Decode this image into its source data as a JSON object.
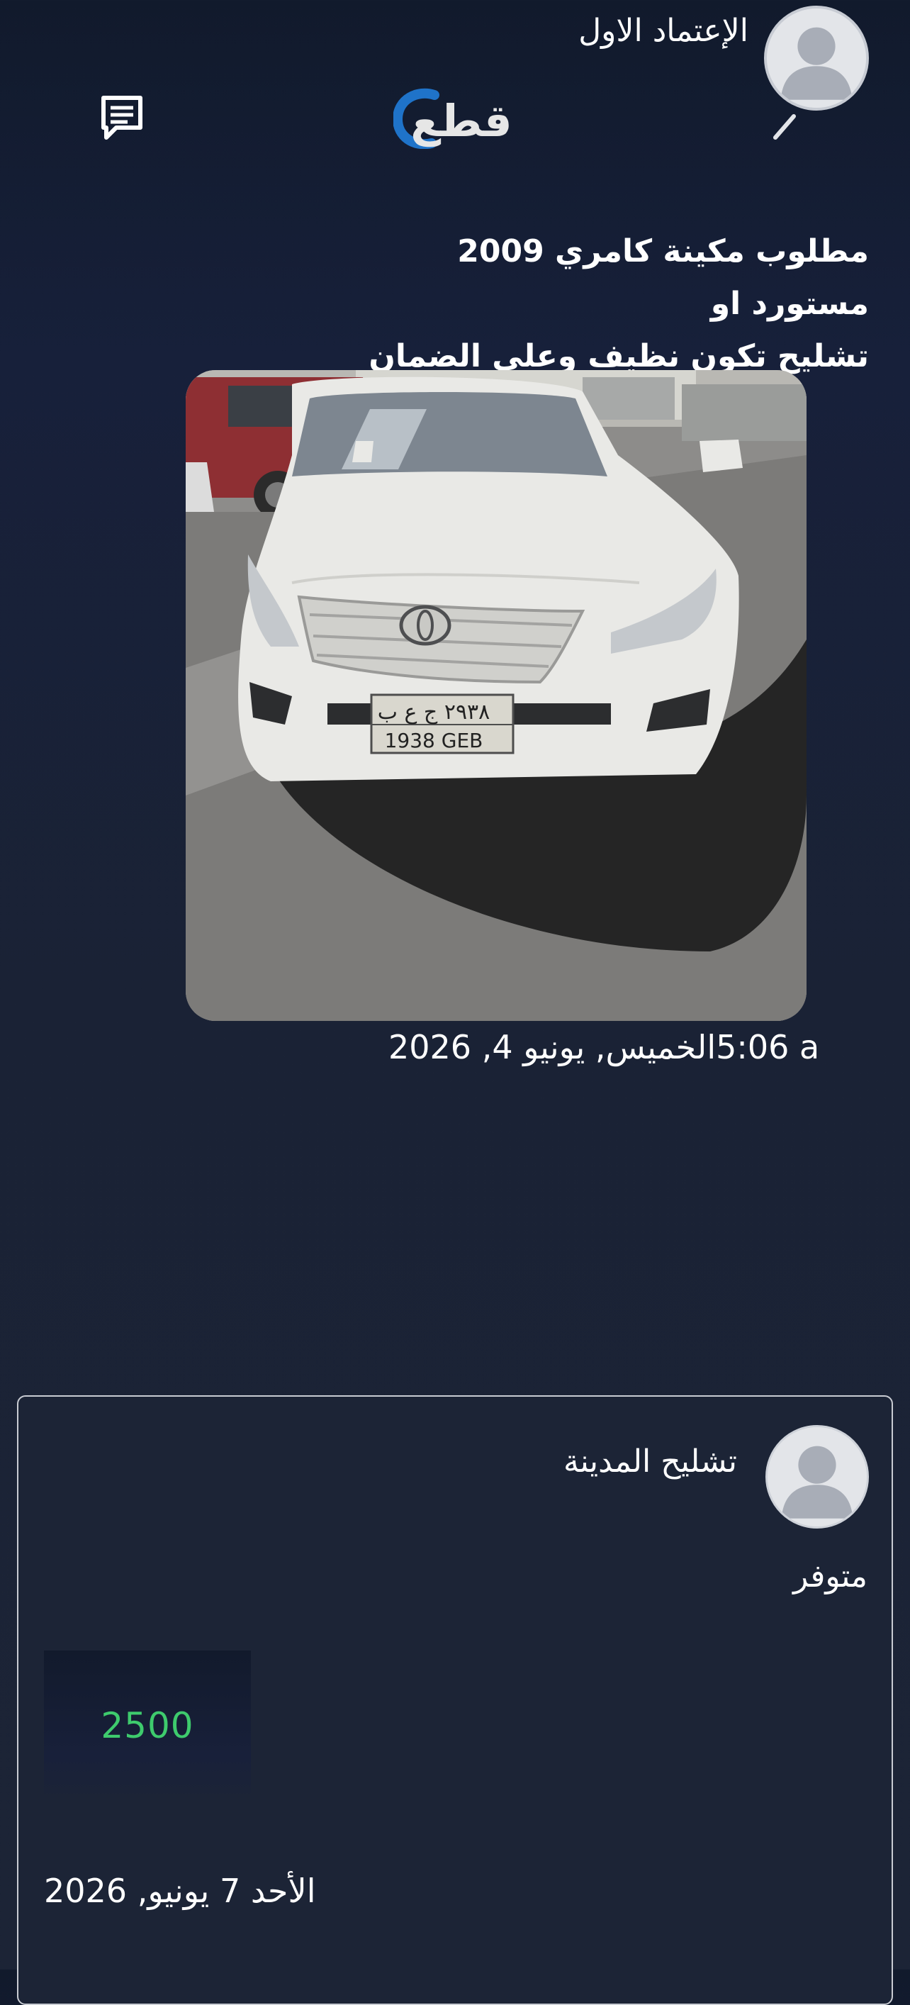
{
  "header": {
    "user_name": "الإعتماد الاول",
    "logo_text": "قطع",
    "icons": {
      "avatar": "user-avatar-icon",
      "messages": "messages-icon"
    }
  },
  "request": {
    "title_line1": "مطلوب مكينة كامري 2009 مستورد او",
    "title_line2": "تشليح تكون نظيف وعلى الضمان",
    "image_alt": "car-photo",
    "plate_text_top": "٢٩٣٨ ج ع ب",
    "plate_text_bottom": "1938 GEB",
    "time": "5:06 a",
    "date": "الخميس, يونيو 4, 2026"
  },
  "offer": {
    "seller_name": "تشليح المدينة",
    "status": "متوفر",
    "price": "2500",
    "date": "الأحد 7 يونيو, 2026"
  },
  "colors": {
    "background": "#17203a",
    "card_border": "#c9ccd3",
    "price": "#3ecb6d",
    "logo_blue": "#1f73c9",
    "text": "#ffffff"
  }
}
